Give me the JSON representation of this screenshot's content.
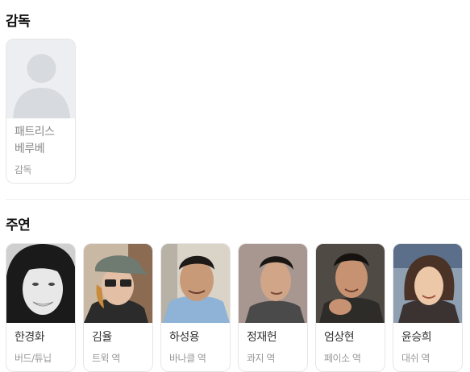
{
  "director_section": {
    "title": "감독",
    "people": [
      {
        "name": "패트리스\n베루베",
        "role": "감독"
      }
    ]
  },
  "cast_section": {
    "title": "주연",
    "people": [
      {
        "name": "한경화",
        "role": "버드/튜닙"
      },
      {
        "name": "김율",
        "role": "트윅 역"
      },
      {
        "name": "하성용",
        "role": "바나클 역"
      },
      {
        "name": "정재헌",
        "role": "콰지 역"
      },
      {
        "name": "엄상현",
        "role": "페이소 역"
      },
      {
        "name": "윤승희",
        "role": "대쉬 역"
      }
    ]
  }
}
